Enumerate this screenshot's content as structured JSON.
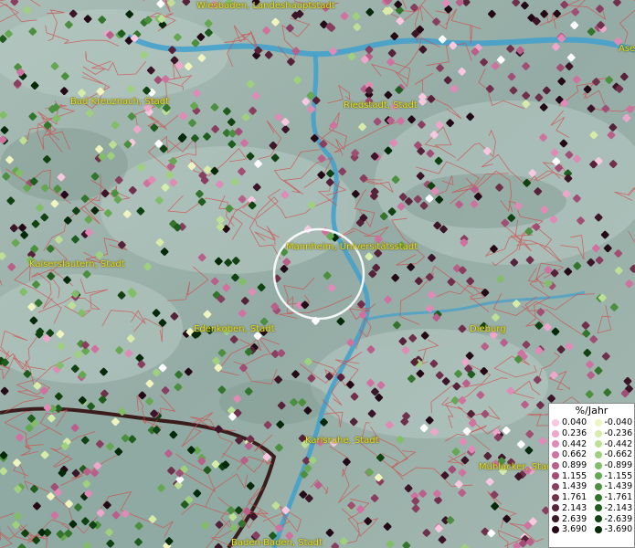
{
  "map": {
    "labels": [
      {
        "name": "Wiesbaden, Landeshauptstadt"
      },
      {
        "name": "Ase"
      },
      {
        "name": "Bad Kreuznach, Stadt"
      },
      {
        "name": "Riedstadt, Stadt"
      },
      {
        "name": "Mannheim, Universitätsstadt"
      },
      {
        "name": "Kaiserslautern, Stadt"
      },
      {
        "name": "Edenkoben, Stadt"
      },
      {
        "name": "Dieburg"
      },
      {
        "name": "Karlsruhe, Stadt"
      },
      {
        "name": "Mühlacker, Stad"
      },
      {
        "name": "Baden-Baden, Stadt"
      }
    ]
  },
  "legend": {
    "title": "%/Jahr",
    "rows": [
      {
        "pos": "0.040",
        "pos_color": "#f7c8e0",
        "neg": "-0.040",
        "neg_color": "#f0f5c0"
      },
      {
        "pos": "0.236",
        "pos_color": "#eea6cb",
        "neg": "-0.236",
        "neg_color": "#d8ecaa"
      },
      {
        "pos": "0.442",
        "pos_color": "#e08ab6",
        "neg": "-0.442",
        "neg_color": "#bde096"
      },
      {
        "pos": "0.662",
        "pos_color": "#cf72a0",
        "neg": "-0.662",
        "neg_color": "#9fd07e"
      },
      {
        "pos": "0.899",
        "pos_color": "#b9608a",
        "neg": "-0.899",
        "neg_color": "#82bd68"
      },
      {
        "pos": "1.155",
        "pos_color": "#a04e74",
        "neg": "-1.155",
        "neg_color": "#66a752"
      },
      {
        "pos": "1.439",
        "pos_color": "#883f5f",
        "neg": "-1.439",
        "neg_color": "#4c8f3e"
      },
      {
        "pos": "1.761",
        "pos_color": "#70304c",
        "neg": "-1.761",
        "neg_color": "#33752c"
      },
      {
        "pos": "2.143",
        "pos_color": "#56223a",
        "neg": "-2.143",
        "neg_color": "#1f5c1e"
      },
      {
        "pos": "2.639",
        "pos_color": "#3c1528",
        "neg": "-2.639",
        "neg_color": "#104212"
      },
      {
        "pos": "3.690",
        "pos_color": "#240a17",
        "neg": "-3.690",
        "neg_color": "#06290a"
      }
    ]
  }
}
